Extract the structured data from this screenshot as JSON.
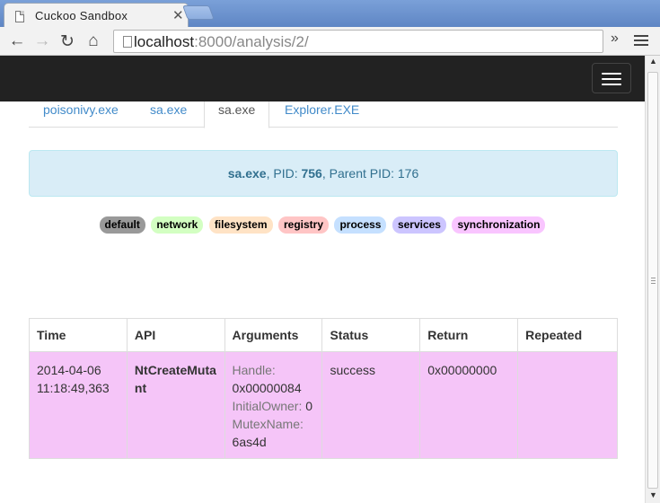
{
  "browser": {
    "tab_title": "Cuckoo Sandbox",
    "close_glyph": "✕",
    "url_host": "localhost",
    "url_path": ":8000/analysis/2/",
    "back_glyph": "←",
    "forward_glyph": "→",
    "reload_glyph": "↻",
    "home_glyph": "⌂",
    "overflow_glyph": "»"
  },
  "process_tabs": [
    {
      "label": "poisonivy.exe"
    },
    {
      "label": "sa.exe"
    },
    {
      "label": "sa.exe"
    },
    {
      "label": "Explorer.EXE"
    }
  ],
  "process_info": {
    "name": "sa.exe",
    "pid_label": ", PID: ",
    "pid": "756",
    "parent_label": ", Parent PID: 176"
  },
  "filters": [
    {
      "label": "default",
      "color": "#999999"
    },
    {
      "label": "network",
      "color": "#d3ffc2"
    },
    {
      "label": "filesystem",
      "color": "#ffe3c5"
    },
    {
      "label": "registry",
      "color": "#ffc5c5"
    },
    {
      "label": "process",
      "color": "#c5e0ff"
    },
    {
      "label": "services",
      "color": "#ccc5ff"
    },
    {
      "label": "synchronization",
      "color": "#f9c5ff"
    }
  ],
  "table": {
    "headers": [
      "Time",
      "API",
      "Arguments",
      "Status",
      "Return",
      "Repeated"
    ],
    "row": {
      "time_date": "2014-04-06",
      "time_clock": "11:18:49,363",
      "api": "NtCreateMutant",
      "args": [
        {
          "name": "Handle:",
          "value": "0x00000084"
        },
        {
          "name": "InitialOwner:",
          "value": "0"
        },
        {
          "name": "MutexName:",
          "value": "6as4d"
        }
      ],
      "status": "success",
      "return": "0x00000000",
      "repeated": ""
    }
  }
}
